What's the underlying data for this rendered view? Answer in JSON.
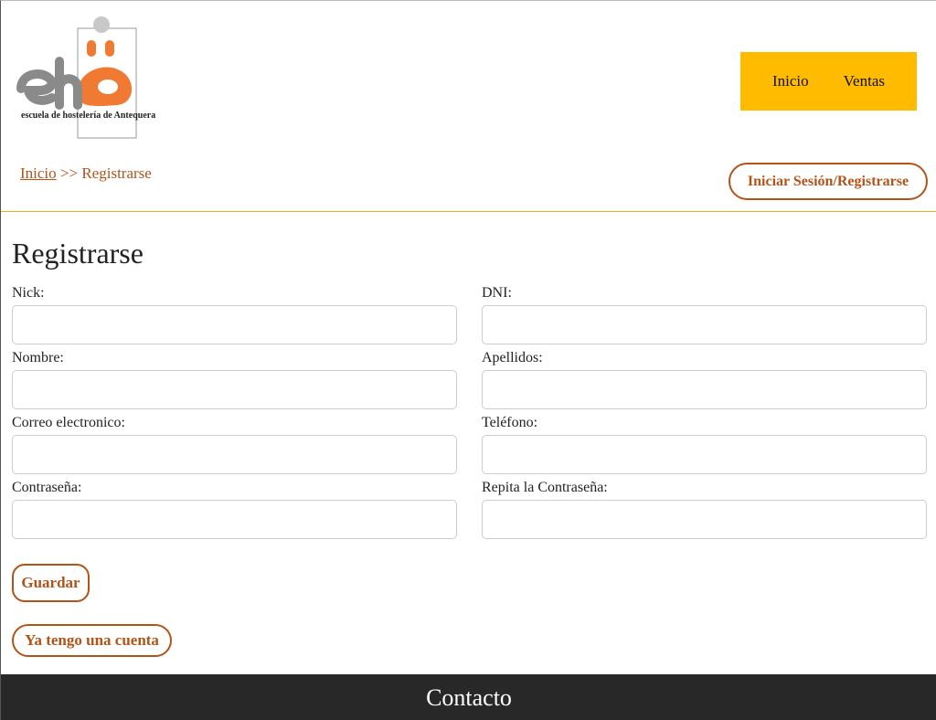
{
  "header": {
    "logo_subtitle": "escuela de hostelería de Antequera",
    "nav": [
      {
        "label": "Inicio"
      },
      {
        "label": "Ventas"
      }
    ],
    "breadcrumb": {
      "home": "Inicio",
      "separator": ">>",
      "current": "Registrarse"
    },
    "login_button": "Iniciar Sesión/Registrarse"
  },
  "form": {
    "title": "Registrarse",
    "fields": [
      {
        "label": "Nick:",
        "value": ""
      },
      {
        "label": "DNI:",
        "value": ""
      },
      {
        "label": "Nombre:",
        "value": ""
      },
      {
        "label": "Apellidos:",
        "value": ""
      },
      {
        "label": "Correo electronico:",
        "value": ""
      },
      {
        "label": "Teléfono:",
        "value": ""
      },
      {
        "label": "Contraseña:",
        "value": ""
      },
      {
        "label": "Repita la Contraseña:",
        "value": ""
      }
    ],
    "save_button": "Guardar",
    "have_account_button": "Ya tengo una cuenta"
  },
  "footer": {
    "title": "Contacto"
  },
  "colors": {
    "accent": "#b25418",
    "nav_bg": "#ffbb00",
    "divider": "#f0b020",
    "logo_orange": "#f07a32",
    "logo_gray": "#8a8a8a",
    "footer_bg": "#282828"
  }
}
